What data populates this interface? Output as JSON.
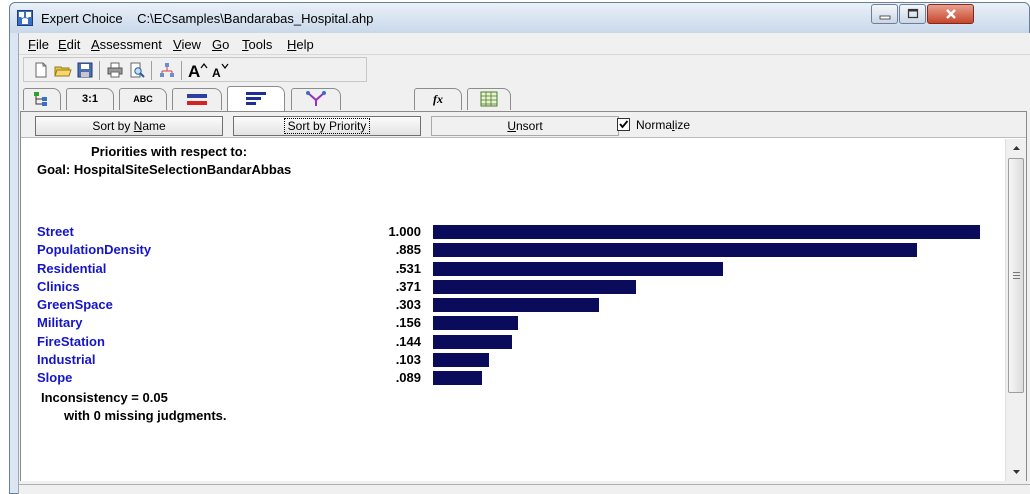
{
  "window": {
    "app_name": "Expert Choice",
    "file_path": "C:\\ECsamples\\Bandarabas_Hospital.ahp"
  },
  "menu": [
    {
      "underline": "F",
      "rest": "ile"
    },
    {
      "underline": "E",
      "rest": "dit"
    },
    {
      "underline": "A",
      "rest": "ssessment"
    },
    {
      "underline": "V",
      "rest": "iew"
    },
    {
      "underline": "G",
      "rest": "o"
    },
    {
      "underline": "T",
      "rest": "ools"
    },
    {
      "underline": "H",
      "rest": "elp"
    }
  ],
  "toolbar": {
    "icons": [
      "new-file-icon",
      "open-folder-icon",
      "save-icon",
      "print-icon",
      "print-preview-icon",
      "tree-view-icon",
      "font-increase-icon",
      "font-decrease-icon"
    ]
  },
  "tabs": [
    {
      "name": "tree-tab-icon",
      "label": ""
    },
    {
      "name": "tab-pairwise",
      "label": "3:1"
    },
    {
      "name": "tab-verbal",
      "label": "ABC"
    },
    {
      "name": "tab-graphical",
      "label": ""
    },
    {
      "name": "tab-priorities",
      "label": ""
    },
    {
      "name": "tab-synthesis",
      "label": ""
    },
    {
      "name": "tab-formula",
      "label": "fx"
    },
    {
      "name": "tab-grid",
      "label": ""
    }
  ],
  "sortbar": {
    "sort_by_name": {
      "before": "Sort by ",
      "underline": "N",
      "after": "ame"
    },
    "sort_by_priority": "Sort by Priority",
    "unsort": {
      "underline": "U",
      "after": "nsort"
    },
    "normalize": {
      "before": "Norma",
      "underline": "l",
      "after": "ize",
      "checked": true
    }
  },
  "priorities": {
    "heading": "Priorities with respect to:",
    "goal": "Goal: HospitalSiteSelectionBandarAbbas",
    "items": [
      {
        "label": "Street",
        "value": "1.000",
        "priority": 1.0
      },
      {
        "label": "PopulationDensity",
        "value": ".885",
        "priority": 0.885
      },
      {
        "label": "Residential",
        "value": ".531",
        "priority": 0.531
      },
      {
        "label": "Clinics",
        "value": ".371",
        "priority": 0.371
      },
      {
        "label": "GreenSpace",
        "value": ".303",
        "priority": 0.303
      },
      {
        "label": "Military",
        "value": ".156",
        "priority": 0.156
      },
      {
        "label": "FireStation",
        "value": ".144",
        "priority": 0.144
      },
      {
        "label": "Industrial",
        "value": ".103",
        "priority": 0.103
      },
      {
        "label": "Slope",
        "value": ".089",
        "priority": 0.089
      }
    ],
    "inconsistency": "Inconsistency = 0.05",
    "missing": "with 0  missing judgments."
  },
  "colors": {
    "bar": "#0b0b5c",
    "label": "#1515c8"
  }
}
